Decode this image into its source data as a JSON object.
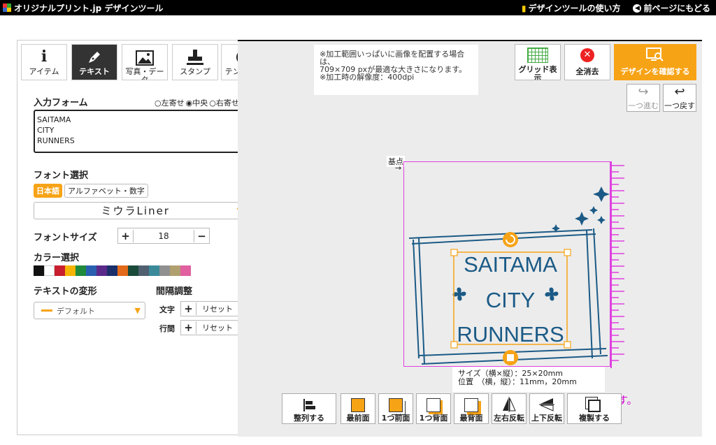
{
  "topbar": {
    "logo_text": "オリジナルプリント.jp デザインツール",
    "howto": "デザインツールの使い方",
    "back": "前ページにもどる"
  },
  "tabs": [
    {
      "label": "アイテム",
      "icon": "i"
    },
    {
      "label": "テキスト",
      "icon": "pen-icon"
    },
    {
      "label": "写真・データ",
      "icon": "image-icon"
    },
    {
      "label": "スタンプ",
      "icon": "stamp-icon"
    },
    {
      "label": "テンプレート",
      "icon": "template-icon"
    }
  ],
  "form": {
    "input_label": "入力フォーム",
    "align": [
      "○左寄せ",
      "◉中央",
      "○右寄せ"
    ],
    "text": "SAITAMA\nCITY\nRUNNERS",
    "font_label": "フォント選択",
    "lang_tabs": [
      "日本語",
      "アルファベット・数字"
    ],
    "font_value": "ミウラLiner",
    "size_label": "フォントサイズ",
    "size_value": "18",
    "plus": "+",
    "minus": "−",
    "color_label": "カラー選択",
    "colors": [
      "#111111",
      "#ffffff",
      "#c81e2e",
      "#f5b400",
      "#1f8a3c",
      "#2a5fb0",
      "#5a2a8a",
      "#1b2f6b",
      "#e26a1a",
      "#1a4a3a",
      "#506070",
      "#3a8a9a",
      "#909090",
      "#b0a070",
      "#e060a0"
    ],
    "transform_label": "テキストの変形",
    "transform_value": "デフォルト",
    "spacing_label": "間隔調整",
    "char_label": "文字",
    "line_label": "行間",
    "reset": "リセット"
  },
  "canvas": {
    "notice": "※加工範囲いっぱいに画像を配置する場合は、\n709×709 pxが最適な大きさになります。\n※加工時の解像度：400dpi",
    "grid": "グリッド表示",
    "clear": "全消去",
    "confirm": "デザインを確認する",
    "redo": "一つ進む",
    "undo": "一つ戻す",
    "base": "基点",
    "design_lines": [
      "SAITAMA",
      "CITY",
      "RUNNERS"
    ],
    "size_info": "サイズ（横×縦）：25×20mm\n位置　（横，縦）：11mm，20mm",
    "pink_text": "ます。",
    "bottom": [
      "整列する",
      "最前面",
      "1つ前面",
      "1つ背面",
      "最背面",
      "左右反転",
      "上下反転",
      "複製する"
    ],
    "accent": "#f7a316",
    "design_color": "#1b5a86"
  }
}
